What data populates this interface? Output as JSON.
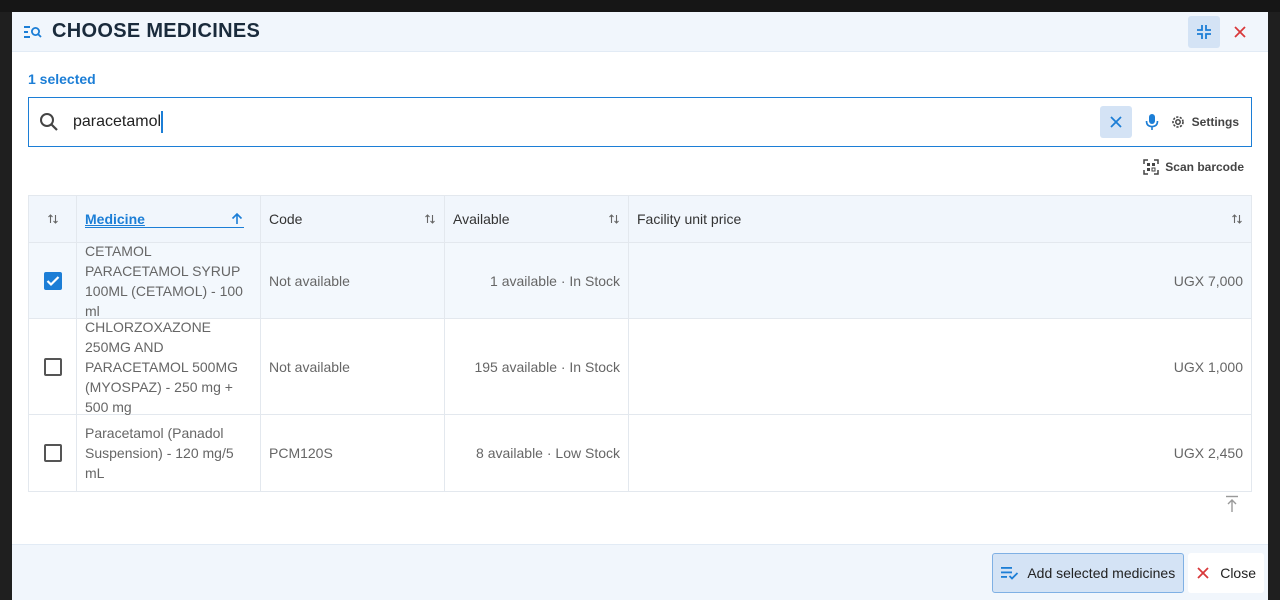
{
  "dialog": {
    "title": "CHOOSE MEDICINES",
    "selected_count": "1 selected"
  },
  "search": {
    "value": "paracetamol",
    "settings_label": "Settings",
    "scan_label": "Scan barcode"
  },
  "table": {
    "headers": [
      "Medicine",
      "Code",
      "Available",
      "Facility unit price"
    ],
    "rows": [
      {
        "checked": true,
        "medicine": "CETAMOL PARACETAMOL SYRUP 100ML (CETAMOL) - 100 ml",
        "code": "Not available",
        "available": "1 available · In Stock",
        "price": "UGX 7,000"
      },
      {
        "checked": false,
        "medicine": "CHLORZOXAZONE 250MG AND PARACETAMOL 500MG (MYOSPAZ) - 250 mg + 500 mg",
        "code": "Not available",
        "available": "195 available · In Stock",
        "price": "UGX 1,000"
      },
      {
        "checked": false,
        "medicine": "Paracetamol (Panadol Suspension) - 120 mg/5 mL",
        "code": "PCM120S",
        "available": "8 available · Low Stock",
        "price": "UGX 2,450"
      }
    ]
  },
  "footer": {
    "add_label": "Add selected medicines",
    "close_label": "Close"
  },
  "colors": {
    "accent": "#1c7ed6",
    "close_red": "#d9383a",
    "header_bg": "#f1f6fc"
  }
}
